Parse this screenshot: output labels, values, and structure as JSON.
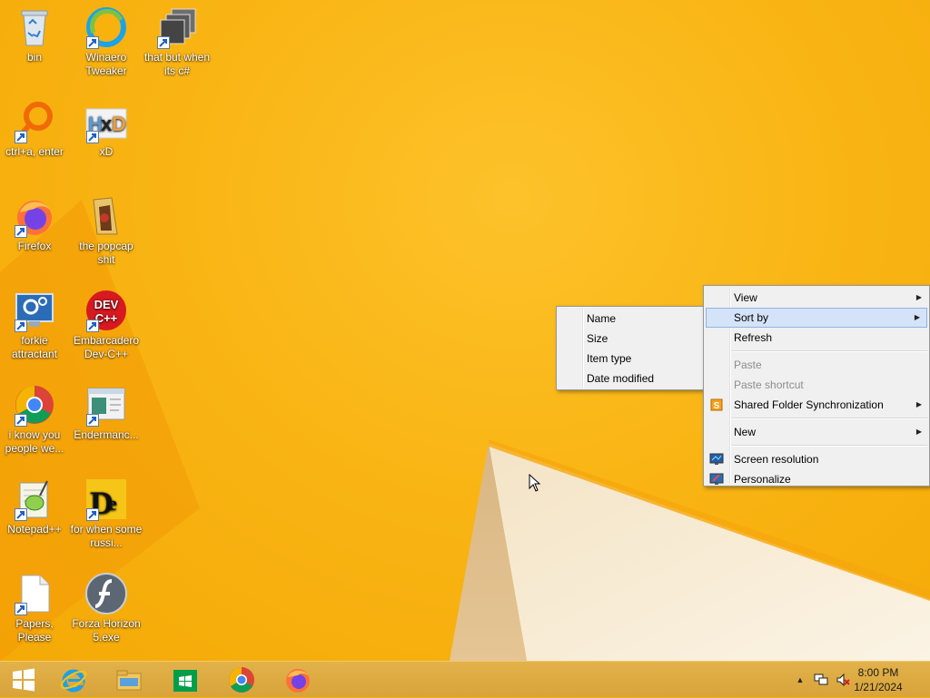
{
  "desktop_icons": [
    {
      "label": "bin",
      "icon": "recycle-bin-icon"
    },
    {
      "label": "Winaero Tweaker",
      "icon": "winaero-icon"
    },
    {
      "label": "that but when its c#",
      "icon": "stacked-windows-icon"
    },
    {
      "label": "ctrl+a, enter",
      "icon": "magnifier-ring-icon"
    },
    {
      "label": "xD",
      "icon": "hxd-icon"
    },
    {
      "label": "Firefox",
      "icon": "firefox-icon"
    },
    {
      "label": "the popcap shit",
      "icon": "folder-icon"
    },
    {
      "label": "forkie attractant",
      "icon": "monitor-gear-icon"
    },
    {
      "label": "Embarcadero Dev-C++",
      "icon": "devcpp-icon"
    },
    {
      "label": "i know you people we...",
      "icon": "chrome-icon"
    },
    {
      "label": "Endermanc...",
      "icon": "window-app-icon"
    },
    {
      "label": "Notepad++",
      "icon": "notepadpp-icon"
    },
    {
      "label": "for when some russi...",
      "icon": "de-app-icon"
    },
    {
      "label": "Papers, Please",
      "icon": "blank-file-icon"
    },
    {
      "label": "Forza Horizon 5.exe",
      "icon": "flash-icon"
    }
  ],
  "context_menu": {
    "items": [
      {
        "label": "View",
        "submenu": true
      },
      {
        "label": "Sort by",
        "submenu": true,
        "highlighted": true
      },
      {
        "label": "Refresh"
      },
      {
        "label": "Paste",
        "disabled": true
      },
      {
        "label": "Paste shortcut",
        "disabled": true
      },
      {
        "label": "Shared Folder Synchronization",
        "submenu": true,
        "icon": "sync-icon"
      },
      {
        "label": "New",
        "submenu": true
      },
      {
        "label": "Screen resolution",
        "icon": "screen-resolution-icon"
      },
      {
        "label": "Personalize",
        "icon": "personalize-icon"
      }
    ]
  },
  "sort_submenu": {
    "items": [
      {
        "label": "Name"
      },
      {
        "label": "Size"
      },
      {
        "label": "Item type"
      },
      {
        "label": "Date modified"
      }
    ]
  },
  "taskbar": {
    "pinned": [
      "start-button",
      "internet-explorer-icon",
      "file-explorer-icon",
      "store-icon",
      "chrome-icon",
      "firefox-icon"
    ],
    "clock": {
      "time": "8:00 PM",
      "date": "1/21/2024"
    },
    "tray": [
      "show-hidden-icons",
      "network-icon",
      "volume-muted-icon"
    ]
  },
  "colors": {
    "accent": "#f7b30a",
    "taskbar": "#dcaa40",
    "menu_highlight": "#d4e3f7"
  }
}
